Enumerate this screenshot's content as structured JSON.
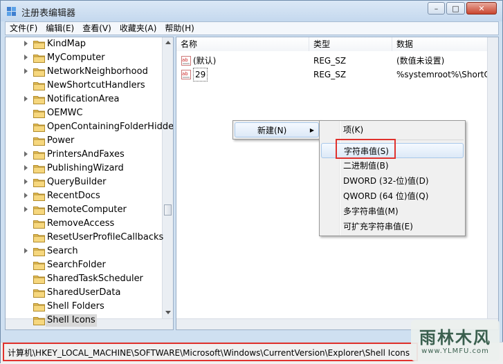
{
  "window": {
    "title": "注册表编辑器"
  },
  "menubar": {
    "items": [
      "文件(F)",
      "编辑(E)",
      "查看(V)",
      "收藏夹(A)",
      "帮助(H)"
    ]
  },
  "tree": {
    "items": [
      {
        "label": "KindMap",
        "expandable": true
      },
      {
        "label": "MyComputer",
        "expandable": true
      },
      {
        "label": "NetworkNeighborhood",
        "expandable": true
      },
      {
        "label": "NewShortcutHandlers",
        "expandable": false
      },
      {
        "label": "NotificationArea",
        "expandable": true
      },
      {
        "label": "OEMWC",
        "expandable": false
      },
      {
        "label": "OpenContainingFolderHidde",
        "expandable": false
      },
      {
        "label": "Power",
        "expandable": false
      },
      {
        "label": "PrintersAndFaxes",
        "expandable": true
      },
      {
        "label": "PublishingWizard",
        "expandable": true
      },
      {
        "label": "QueryBuilder",
        "expandable": true
      },
      {
        "label": "RecentDocs",
        "expandable": true
      },
      {
        "label": "RemoteComputer",
        "expandable": true
      },
      {
        "label": "RemoveAccess",
        "expandable": false
      },
      {
        "label": "ResetUserProfileCallbacks",
        "expandable": false
      },
      {
        "label": "Search",
        "expandable": true
      },
      {
        "label": "SearchFolder",
        "expandable": false
      },
      {
        "label": "SharedTaskScheduler",
        "expandable": false
      },
      {
        "label": "SharedUserData",
        "expandable": false
      },
      {
        "label": "Shell Folders",
        "expandable": false
      },
      {
        "label": "Shell Icons",
        "expandable": false,
        "selected": true
      }
    ]
  },
  "list": {
    "columns": [
      "名称",
      "类型",
      "数据"
    ],
    "rows": [
      {
        "name": "(默认)",
        "type": "REG_SZ",
        "data": "(数值未设置)"
      },
      {
        "name": "29",
        "type": "REG_SZ",
        "data": "%systemroot%\\ShortCut."
      }
    ]
  },
  "context_menu": {
    "new_label": "新建(N)"
  },
  "submenu": {
    "items": [
      "项(K)",
      "字符串值(S)",
      "二进制值(B)",
      "DWORD (32-位)值(D)",
      "QWORD (64 位)值(Q)",
      "多字符串值(M)",
      "可扩充字符串值(E)"
    ]
  },
  "statusbar": {
    "path": "计算机\\HKEY_LOCAL_MACHINE\\SOFTWARE\\Microsoft\\Windows\\CurrentVersion\\Explorer\\Shell Icons"
  },
  "watermark": {
    "logo": "雨林木风",
    "url": "www.YLMFU.com"
  },
  "colors": {
    "highlight_box": "#e0312d",
    "folder": "#e8c25a"
  }
}
